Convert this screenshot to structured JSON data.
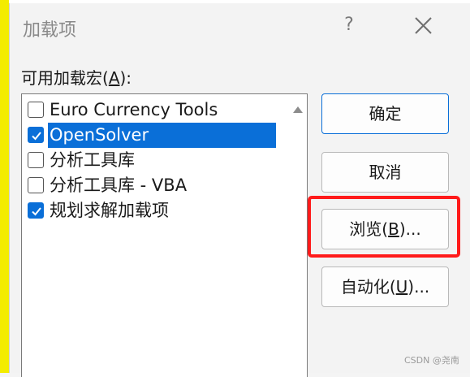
{
  "dialog": {
    "title": "加载项",
    "help_label": "?"
  },
  "addins": {
    "label_prefix": "可用加载宏(",
    "label_accel": "A",
    "label_suffix": "):",
    "items": [
      {
        "label": "Euro Currency Tools",
        "checked": false,
        "selected": false
      },
      {
        "label": "OpenSolver",
        "checked": true,
        "selected": true
      },
      {
        "label": "分析工具库",
        "checked": false,
        "selected": false
      },
      {
        "label": "分析工具库 - VBA",
        "checked": false,
        "selected": false
      },
      {
        "label": "规划求解加载项",
        "checked": true,
        "selected": false
      }
    ]
  },
  "buttons": {
    "ok": "确定",
    "cancel": "取消",
    "browse_prefix": "浏览(",
    "browse_accel": "B",
    "browse_suffix": ")...",
    "automation_prefix": "自动化(",
    "automation_accel": "U",
    "automation_suffix": ")..."
  },
  "colors": {
    "accent": "#0a6fd8",
    "highlight_box": "#ff1a1a",
    "excel_background": "#f3ec00"
  },
  "watermark": "CSDN @尧南"
}
